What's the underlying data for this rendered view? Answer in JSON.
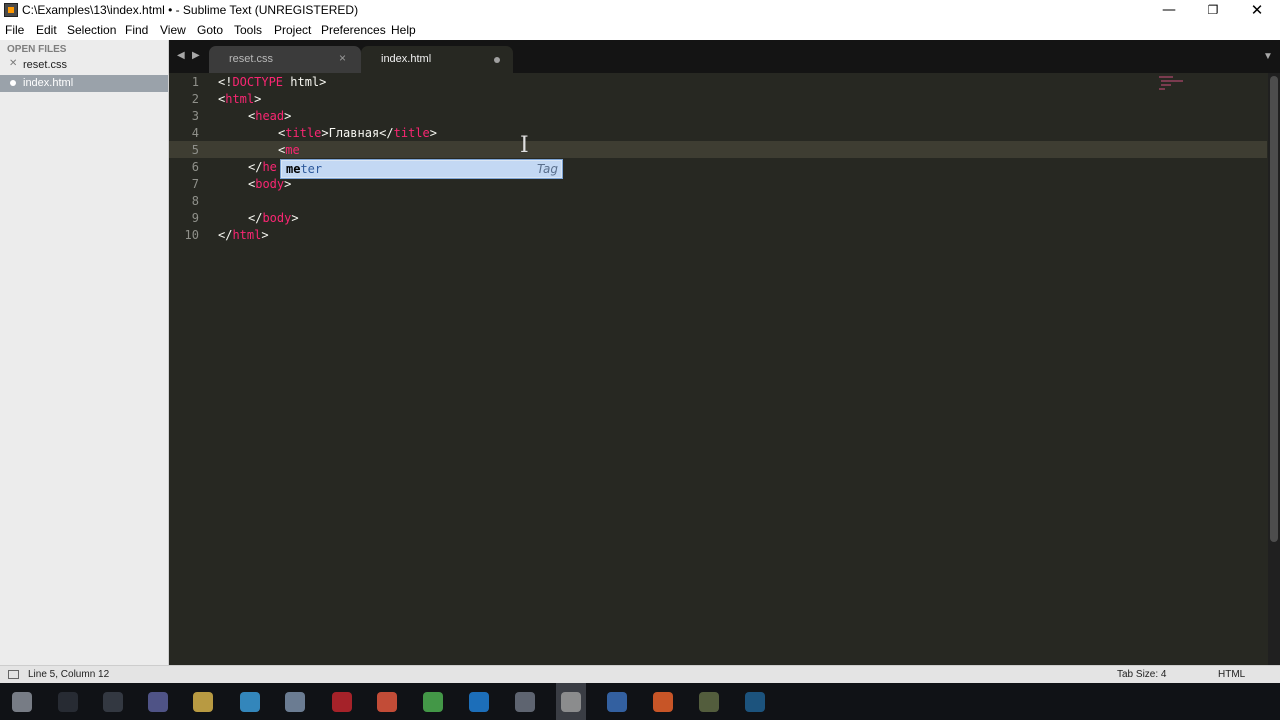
{
  "window": {
    "title": "C:\\Examples\\13\\index.html • - Sublime Text (UNREGISTERED)",
    "controls": {
      "minimize": "—",
      "maximize": "❐",
      "close": "✕"
    }
  },
  "menu": [
    "File",
    "Edit",
    "Selection",
    "Find",
    "View",
    "Goto",
    "Tools",
    "Project",
    "Preferences",
    "Help"
  ],
  "sidebar": {
    "header": "OPEN FILES",
    "files": [
      {
        "name": "reset.css",
        "active": false
      },
      {
        "name": "index.html",
        "active": true
      }
    ]
  },
  "tabs": [
    {
      "label": "reset.css",
      "active": false,
      "close": "×"
    },
    {
      "label": "index.html",
      "active": true,
      "modified": true
    }
  ],
  "tab_nav": {
    "left": "◀",
    "right": "▶",
    "dropdown": "▼"
  },
  "editor": {
    "gutter": [
      "1",
      "2",
      "3",
      "4",
      "5",
      "6",
      "7",
      "8",
      "9",
      "10"
    ],
    "current_line": 5,
    "lines": {
      "l1": {
        "a": "<!",
        "b": "DOCTYPE",
        "c": " html>"
      },
      "l2": {
        "a": "<",
        "b": "html",
        "c": ">"
      },
      "l3": {
        "a": "<",
        "b": "head",
        "c": ">"
      },
      "l4": {
        "a": "<",
        "b": "title",
        "c": ">",
        "d": "Главная",
        "e": "</",
        "f": "title",
        "g": ">"
      },
      "l5": {
        "a": "<",
        "b": "me"
      },
      "l6": {
        "a": "</",
        "b": "he"
      },
      "l7": {
        "a": "<",
        "b": "body",
        "c": ">"
      },
      "l9": {
        "a": "</",
        "b": "body",
        "c": ">"
      },
      "l10": {
        "a": "</",
        "b": "html",
        "c": ">"
      }
    },
    "colors": {
      "background": "#272822",
      "tag": "#f92672",
      "text": "#f8f8f2",
      "gutter": "#8f908a"
    }
  },
  "autocomplete": {
    "match": "me",
    "rest": "ter",
    "kind": "Tag"
  },
  "status": {
    "position": "Line 5, Column 12",
    "tab_size": "Tab Size: 4",
    "syntax": "HTML"
  },
  "taskbar": {
    "icons": [
      "start-icon",
      "search-icon",
      "task-view-icon",
      "app-icon",
      "folder-icon",
      "browser-icon",
      "settings-icon",
      "opera-icon",
      "store-icon",
      "chrome-icon",
      "ie-icon",
      "media-icon",
      "sublime-icon",
      "app-icon",
      "firefox-icon",
      "app-icon",
      "photoshop-icon"
    ]
  }
}
